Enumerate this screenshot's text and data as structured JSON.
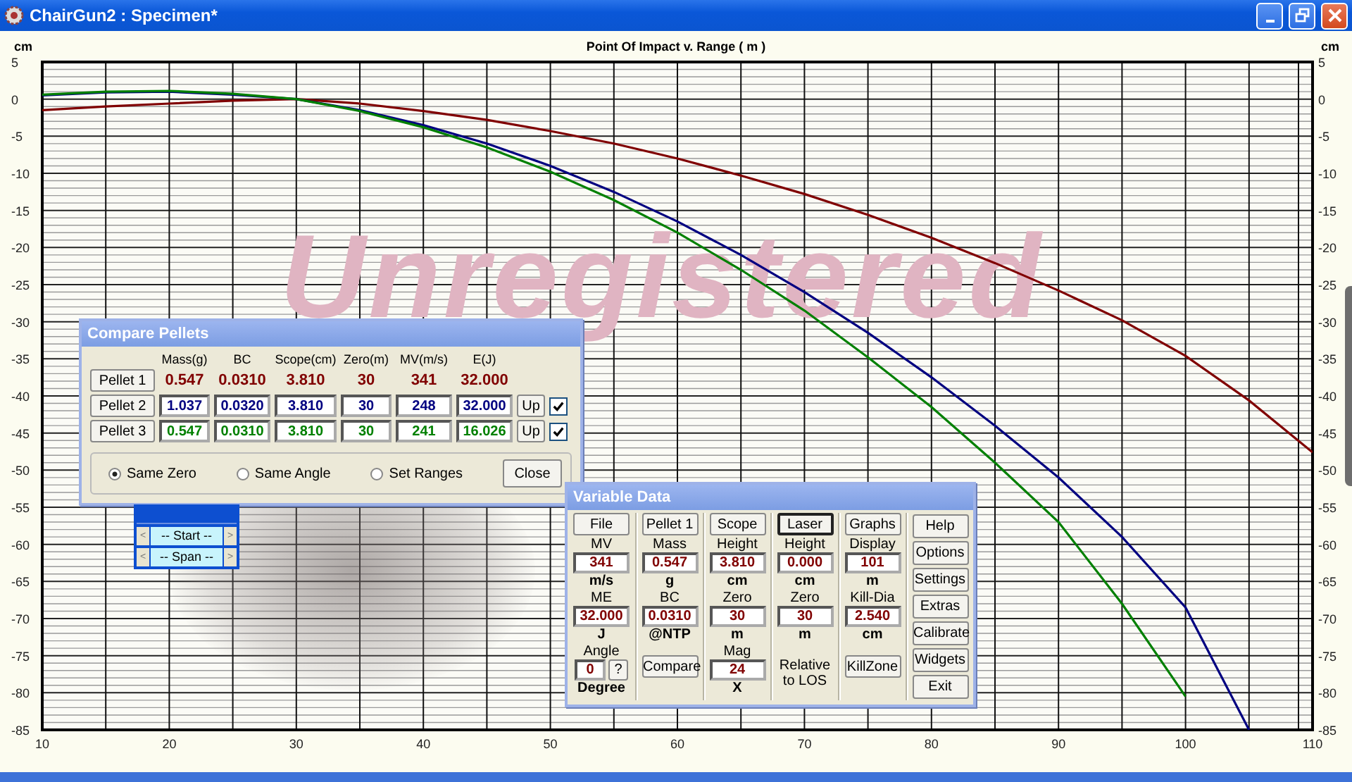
{
  "window": {
    "title": "ChairGun2 : Specimen*",
    "controls": [
      {
        "kind": "minimize"
      },
      {
        "kind": "restore"
      },
      {
        "kind": "close"
      }
    ]
  },
  "graph": {
    "left_ticks": [
      "5",
      "0",
      "-5",
      "-10",
      "-15",
      "-20",
      "-25",
      "-30",
      "-35",
      "-40",
      "-45",
      "-50",
      "-55",
      "-60",
      "-65",
      "-70",
      "-75",
      "-80",
      "-85"
    ],
    "unit_right": "cm",
    "watermark": "Unregistered",
    "chart_data": {
      "type": "line",
      "title": "Point Of Impact v. Range ( m )",
      "ylabel": "cm",
      "x": [
        10,
        15,
        20,
        25,
        30,
        35,
        40,
        45,
        50,
        55,
        60,
        65,
        70,
        75,
        80,
        85,
        90,
        95,
        100,
        105,
        110
      ],
      "series": [
        {
          "color": "#800000",
          "values": [
            -1.5,
            -1.0,
            -0.6,
            -0.2,
            0,
            -0.6,
            -1.6,
            -2.8,
            -4.3,
            -6.0,
            -8.0,
            -10.3,
            -12.8,
            -15.6,
            -18.7,
            -22.1,
            -25.8,
            -29.8,
            -34.6,
            -40.6,
            -47.6
          ]
        },
        {
          "color": "#000080",
          "values": [
            0.5,
            0.9,
            1.0,
            0.6,
            0,
            -1.5,
            -3.5,
            -6.0,
            -9.0,
            -12.5,
            -16.5,
            -21.0,
            -26.0,
            -31.5,
            -37.5,
            -44.0,
            -51.0,
            -59.0,
            -68.5,
            -85.0,
            null
          ]
        },
        {
          "color": "#008000",
          "values": [
            0.6,
            1.0,
            1.1,
            0.7,
            0,
            -1.6,
            -3.8,
            -6.5,
            -9.8,
            -13.6,
            -18.0,
            -23.0,
            -28.5,
            -34.8,
            -41.5,
            -49.0,
            -57.0,
            -68.0,
            -80.5,
            null,
            null
          ]
        }
      ],
      "grid": true,
      "xlim": [
        10,
        110
      ],
      "ylim": [
        -85,
        5
      ],
      "xticks": [
        10,
        20,
        30,
        40,
        50,
        60,
        70,
        80,
        90,
        100,
        110
      ],
      "yticks": [
        5,
        0,
        -5,
        -10,
        -15,
        -20,
        -25,
        -30,
        -35,
        -40,
        -45,
        -50,
        -55,
        -60,
        -65,
        -70,
        -75,
        -80,
        -85
      ]
    }
  },
  "compare_pellets": {
    "title": "Compare Pellets",
    "columns": [
      "Mass(g)",
      "BC",
      "Scope(cm)",
      "Zero(m)",
      "MV(m/s)",
      "E(J)"
    ],
    "rows": [
      {
        "label": "Pellet 1",
        "kind": "readonly",
        "color": "#800000",
        "values": [
          "0.547",
          "0.0310",
          "3.810",
          "30",
          "341",
          "32.000"
        ]
      },
      {
        "label": "Pellet 2",
        "kind": "editable",
        "color": "#000080",
        "values": [
          "1.037",
          "0.0320",
          "3.810",
          "30",
          "248",
          "32.000"
        ],
        "up": "Up",
        "checked": true
      },
      {
        "label": "Pellet 3",
        "kind": "editable",
        "color": "#008000",
        "values": [
          "0.547",
          "0.0310",
          "3.810",
          "30",
          "241",
          "16.026"
        ],
        "up": "Up",
        "checked": true
      }
    ],
    "options": [
      {
        "label": "Same Zero",
        "selected": true
      },
      {
        "label": "Same Angle",
        "selected": false
      },
      {
        "label": "Set Ranges",
        "selected": false
      }
    ],
    "close": "Close"
  },
  "range_widget": {
    "rows": [
      {
        "left": "<",
        "label": "-- Start --",
        "right": ">"
      },
      {
        "left": "<",
        "label": "-- Span --",
        "right": ">"
      }
    ]
  },
  "variable_data": {
    "title": "Variable Data",
    "columns": [
      {
        "items": [
          {
            "kind": "button",
            "text": "File",
            "focused": false
          },
          {
            "kind": "label",
            "text": "MV"
          },
          {
            "kind": "field",
            "value": "341"
          },
          {
            "kind": "unit",
            "text": "m/s"
          },
          {
            "kind": "label",
            "text": "ME"
          },
          {
            "kind": "field",
            "value": "32.000"
          },
          {
            "kind": "unit",
            "text": "J"
          },
          {
            "kind": "label",
            "text": "Angle"
          },
          {
            "kind": "field_help",
            "value": "0",
            "help": "?"
          },
          {
            "kind": "unit",
            "text": "Degree"
          }
        ]
      },
      {
        "items": [
          {
            "kind": "button",
            "text": "Pellet 1",
            "focused": false
          },
          {
            "kind": "label",
            "text": "Mass"
          },
          {
            "kind": "field",
            "value": "0.547"
          },
          {
            "kind": "unit",
            "text": "g"
          },
          {
            "kind": "label",
            "text": "BC"
          },
          {
            "kind": "field",
            "value": "0.0310"
          },
          {
            "kind": "unit",
            "text": "@NTP"
          },
          {
            "kind": "button",
            "text": "Compare",
            "focused": false
          }
        ]
      },
      {
        "items": [
          {
            "kind": "button",
            "text": "Scope",
            "focused": false
          },
          {
            "kind": "label",
            "text": "Height"
          },
          {
            "kind": "field",
            "value": "3.810"
          },
          {
            "kind": "unit",
            "text": "cm"
          },
          {
            "kind": "label",
            "text": "Zero"
          },
          {
            "kind": "field",
            "value": "30"
          },
          {
            "kind": "unit",
            "text": "m"
          },
          {
            "kind": "label",
            "text": "Mag"
          },
          {
            "kind": "field",
            "value": "24"
          },
          {
            "kind": "unit",
            "text": "X"
          }
        ]
      },
      {
        "items": [
          {
            "kind": "button",
            "text": "Laser",
            "focused": true
          },
          {
            "kind": "label",
            "text": "Height"
          },
          {
            "kind": "field",
            "value": "0.000"
          },
          {
            "kind": "unit",
            "text": "cm"
          },
          {
            "kind": "label",
            "text": "Zero"
          },
          {
            "kind": "field",
            "value": "30"
          },
          {
            "kind": "unit",
            "text": "m"
          },
          {
            "kind": "note",
            "text": "Relative to LOS"
          }
        ]
      },
      {
        "items": [
          {
            "kind": "button",
            "text": "Graphs",
            "focused": false
          },
          {
            "kind": "label",
            "text": "Display"
          },
          {
            "kind": "field",
            "value": "101"
          },
          {
            "kind": "unit",
            "text": "m"
          },
          {
            "kind": "label",
            "text": "Kill-Dia"
          },
          {
            "kind": "field",
            "value": "2.540"
          },
          {
            "kind": "unit",
            "text": "cm"
          },
          {
            "kind": "button",
            "text": "KillZone",
            "focused": false
          }
        ]
      },
      {
        "items": [
          {
            "kind": "side_button",
            "text": "Help",
            "focused": false
          },
          {
            "kind": "side_button",
            "text": "Options",
            "focused": false
          },
          {
            "kind": "side_button",
            "text": "Settings",
            "focused": false
          },
          {
            "kind": "side_button",
            "text": "Extras",
            "focused": false
          },
          {
            "kind": "side_button",
            "text": "Calibrate",
            "focused": false
          },
          {
            "kind": "side_button",
            "text": "Widgets",
            "focused": false
          },
          {
            "kind": "side_button",
            "text": "Exit",
            "focused": false
          }
        ]
      }
    ]
  }
}
